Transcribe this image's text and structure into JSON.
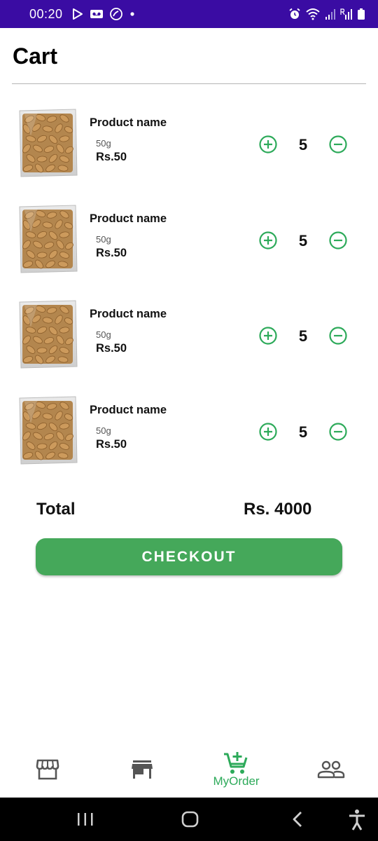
{
  "status_bar": {
    "time": "00:20",
    "left_icons": [
      "play-store-icon",
      "voicemail-icon",
      "missed-call-icon",
      "dot-icon"
    ],
    "right_icons": [
      "alarm-icon",
      "wifi-icon",
      "signal-icon",
      "signal-roaming-icon",
      "battery-icon"
    ],
    "colors": {
      "background": "#3a0ca3",
      "foreground": "#ffffff"
    }
  },
  "header": {
    "title": "Cart"
  },
  "cart": {
    "items": [
      {
        "name": "Product name",
        "weight": "50g",
        "price": "Rs.50",
        "quantity": "5",
        "image": "almond-pack-image"
      },
      {
        "name": "Product name",
        "weight": "50g",
        "price": "Rs.50",
        "quantity": "5",
        "image": "almond-pack-image"
      },
      {
        "name": "Product name",
        "weight": "50g",
        "price": "Rs.50",
        "quantity": "5",
        "image": "almond-pack-image"
      },
      {
        "name": "Product name",
        "weight": "50g",
        "price": "Rs.50",
        "quantity": "5",
        "image": "almond-pack-image"
      }
    ],
    "increment_icon": "plus-circle-icon",
    "decrement_icon": "minus-circle-icon"
  },
  "summary": {
    "total_label": "Total",
    "total_value": "Rs. 4000"
  },
  "checkout": {
    "label": "CHECKOUT"
  },
  "bottom_nav": {
    "items": [
      {
        "icon": "storefront-icon",
        "label": ""
      },
      {
        "icon": "store-icon",
        "label": ""
      },
      {
        "icon": "cart-add-icon",
        "label": "MyOrder",
        "active": true
      },
      {
        "icon": "people-icon",
        "label": ""
      }
    ]
  },
  "system_nav": {
    "buttons": [
      "recents-icon",
      "home-icon",
      "back-icon",
      "accessibility-icon"
    ]
  },
  "colors": {
    "accent_green": "#2daa5a",
    "button_green": "#45a85a",
    "icon_gray": "#555555"
  }
}
